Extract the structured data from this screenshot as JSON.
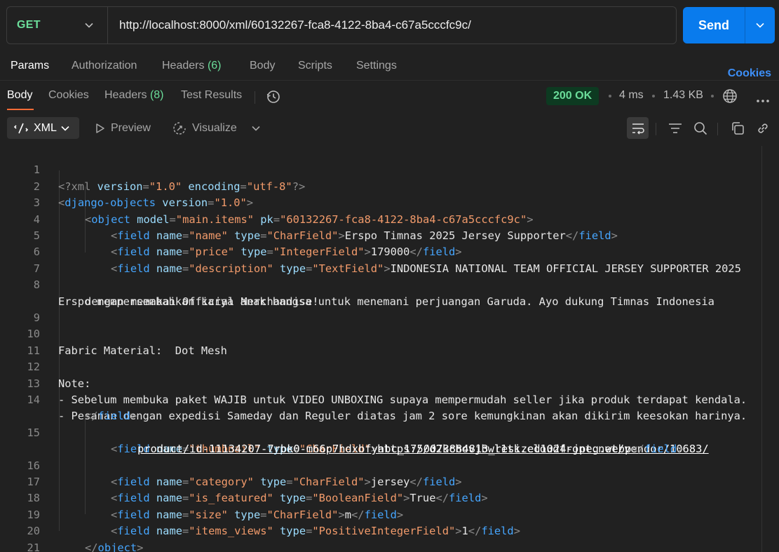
{
  "request": {
    "method": "GET",
    "url": "http://localhost:8000/xml/60132267-fca8-4122-8ba4-c67a5cccfc9c/",
    "send_label": "Send"
  },
  "request_tabs": {
    "params": "Params",
    "authorization": "Authorization",
    "headers": "Headers",
    "headers_count": "(6)",
    "body": "Body",
    "scripts": "Scripts",
    "settings": "Settings",
    "cookies": "Cookies"
  },
  "response_tabs": {
    "body": "Body",
    "cookies": "Cookies",
    "headers": "Headers",
    "headers_count": "(8)",
    "test_results": "Test Results",
    "status": "200 OK",
    "time": "4 ms",
    "size": "1.43 KB"
  },
  "toolbar": {
    "format": "XML",
    "preview": "Preview",
    "visualize": "Visualize"
  },
  "code": {
    "line_numbers": [
      "1",
      "2",
      "3",
      "4",
      "5",
      "6",
      "7",
      "8",
      "9",
      "10",
      "11",
      "12",
      "13",
      "14",
      "15",
      "16",
      "17",
      "18",
      "19",
      "20",
      "21"
    ],
    "pi": "<?xml",
    "pi_version_attr": "version",
    "pi_version_val": "\"1.0\"",
    "pi_encoding_attr": "encoding",
    "pi_encoding_val": "\"utf-8\"",
    "pi_end": "?>",
    "root_tag": "django-objects",
    "version_attr": "version",
    "version_val": "\"1.0\"",
    "object_tag": "object",
    "model_attr": "model",
    "model_val": "\"main.items\"",
    "pk_attr": "pk",
    "pk_val": "\"60132267-fca8-4122-8ba4-c67a5cccfc9c\"",
    "field_tag": "field",
    "name_attr": "name",
    "type_attr": "type",
    "fields": [
      {
        "name": "\"name\"",
        "type": "\"CharField\"",
        "value": "Erspo Timnas 2025 Jersey Supporter"
      },
      {
        "name": "\"price\"",
        "type": "\"IntegerField\"",
        "value": "179000"
      },
      {
        "name": "\"description\"",
        "type": "\"TextField\"",
        "value": "INDONESIA NATIONAL TEAM OFFICIAL JERSEY SUPPORTER 2025"
      },
      {
        "name": "\"thumbnail\"",
        "type": "\"CharField\"",
        "value": "https://d2kchovjbwl1tk.cloudfront.net/vendor/10683/",
        "value_cont": "product/id-11134207-7rbk0-m66p7hdxbfyabc_1750073884813_resized1024-jpeg.webp"
      },
      {
        "name": "\"category\"",
        "type": "\"CharField\"",
        "value": "jersey"
      },
      {
        "name": "\"is_featured\"",
        "type": "\"BooleanField\"",
        "value": "True"
      },
      {
        "name": "\"size\"",
        "type": "\"CharField\"",
        "value": "m"
      },
      {
        "name": "\"items_views\"",
        "type": "\"PositiveIntegerField\"",
        "value": "1"
      }
    ],
    "desc_line_8a": "Erspo mempersembahkan karya anak bangsa untuk menemani perjuangan Garuda. Ayo dukung Timnas Indonesia",
    "desc_line_8b": "dengan memakai Official Merchandise!",
    "desc_line_10": "Fabric Material:  Dot Mesh",
    "desc_line_12": "Note:",
    "desc_line_13": "- Sebelum membuka paket WAJIB untuk VIDEO UNBOXING supaya mempermudah seller jika produk terdapat kendala.",
    "desc_line_14": "- Pesanan dengan expedisi Sameday dan Reguler diatas jam 2 sore kemungkinan akan dikirim keesokan harinya."
  }
}
